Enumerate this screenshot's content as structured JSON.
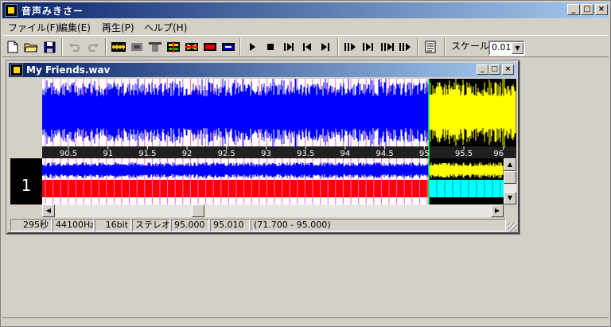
{
  "app": {
    "title": "音声みきさー"
  },
  "menu": [
    "ファイル(F)",
    "編集(E)",
    "再生(P)",
    "ヘルプ(H)"
  ],
  "toolbar": {
    "icons": [
      "new-file-icon",
      "open-folder-icon",
      "save-icon",
      "undo-icon",
      "redo-icon",
      "effect-1-icon",
      "effect-2-icon",
      "effect-3-icon",
      "effect-4-icon",
      "effect-5-icon",
      "effect-6-icon",
      "effect-7-icon",
      "play-icon",
      "stop-icon",
      "step-forward-icon",
      "go-start-icon",
      "go-end-icon",
      "mark-1-icon",
      "mark-2-icon",
      "mark-3-icon",
      "mark-4-icon",
      "memo-icon"
    ],
    "scale_label": "スケール",
    "scale_value": "0.01"
  },
  "child": {
    "title": "My Friends.wav",
    "track_number": "1",
    "ticks": [
      "90.5",
      "91",
      "91.5",
      "92",
      "92.5",
      "93",
      "93.5",
      "94",
      "94.5",
      "95",
      "95.5",
      "96"
    ],
    "colors": {
      "wave": "#0000ff",
      "selected_wave": "#ffff00",
      "marker": "#ff0000",
      "selected_marker": "#00ffff",
      "timeline_bg": "#202020"
    }
  },
  "status": {
    "duration": "295秒",
    "sample_rate": "44100Hz",
    "bit_depth": "16bit",
    "channels": "ステレオ",
    "pos_start": "95.000",
    "pos_end": "95.010",
    "selection": "(71.700 - 95.000)"
  }
}
